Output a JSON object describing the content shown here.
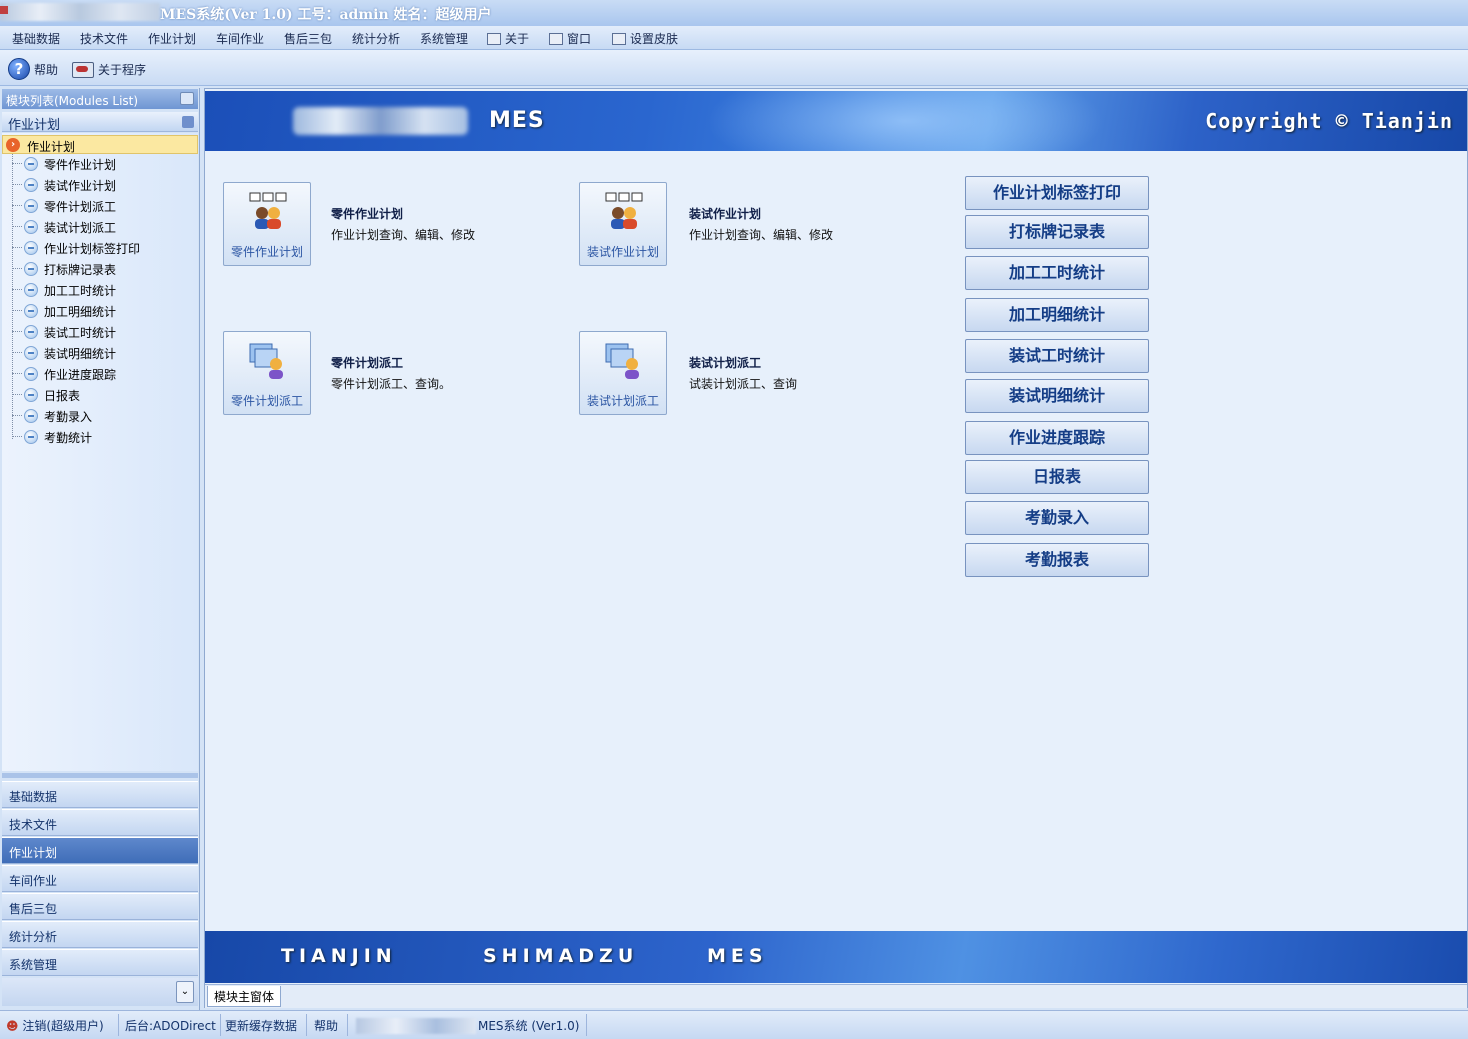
{
  "window": {
    "title": "MES系统(Ver 1.0) 工号：admin  姓名：超级用户"
  },
  "menu": {
    "items": [
      "基础数据",
      "技术文件",
      "作业计划",
      "车间作业",
      "售后三包",
      "统计分析",
      "系统管理"
    ],
    "about": "关于",
    "window": "窗口",
    "skin": "设置皮肤"
  },
  "toolbar": {
    "help": "帮助",
    "about_program": "关于程序"
  },
  "left": {
    "header": "模块列表(Modules List)",
    "section": "作业计划",
    "tree_root": "作业计划",
    "tree_items": [
      "零件作业计划",
      "装试作业计划",
      "零件计划派工",
      "装试计划派工",
      "作业计划标签打印",
      "打标牌记录表",
      "加工工时统计",
      "加工明细统计",
      "装试工时统计",
      "装试明细统计",
      "作业进度跟踪",
      "日报表",
      "考勤录入",
      "考勤统计"
    ],
    "nav": [
      "基础数据",
      "技术文件",
      "作业计划",
      "车间作业",
      "售后三包",
      "统计分析",
      "系统管理"
    ],
    "nav_selected": "作业计划"
  },
  "banner": {
    "mes": "MES",
    "copyright": "Copyright © Tianjin"
  },
  "modules": [
    {
      "caption": "零件作业计划",
      "title": "零件作业计划",
      "desc": "作业计划查询、编辑、修改"
    },
    {
      "caption": "装试作业计划",
      "title": "装试作业计划",
      "desc": "作业计划查询、编辑、修改"
    },
    {
      "caption": "零件计划派工",
      "title": "零件计划派工",
      "desc": "零件计划派工、查询。"
    },
    {
      "caption": "装试计划派工",
      "title": "装试计划派工",
      "desc": "试装计划派工、查询"
    }
  ],
  "right_buttons": [
    "作业计划标签打印",
    "打标牌记录表",
    "加工工时统计",
    "加工明细统计",
    "装试工时统计",
    "装试明细统计",
    "作业进度跟踪",
    "日报表",
    "考勤录入",
    "考勤报表"
  ],
  "footer_banner": [
    "TIANJIN",
    "SHIMADZU",
    "MES"
  ],
  "tabs": [
    "模块主窗体"
  ],
  "status": {
    "logout": "注销(超级用户)",
    "backend": "后台:ADODirect",
    "refresh": "更新缓存数据",
    "help": "帮助",
    "system": "MES系统  (Ver1.0)"
  },
  "colors": {
    "banner": "#2a66cf",
    "accent": "#143d86",
    "selection": "#fbe8a1"
  }
}
